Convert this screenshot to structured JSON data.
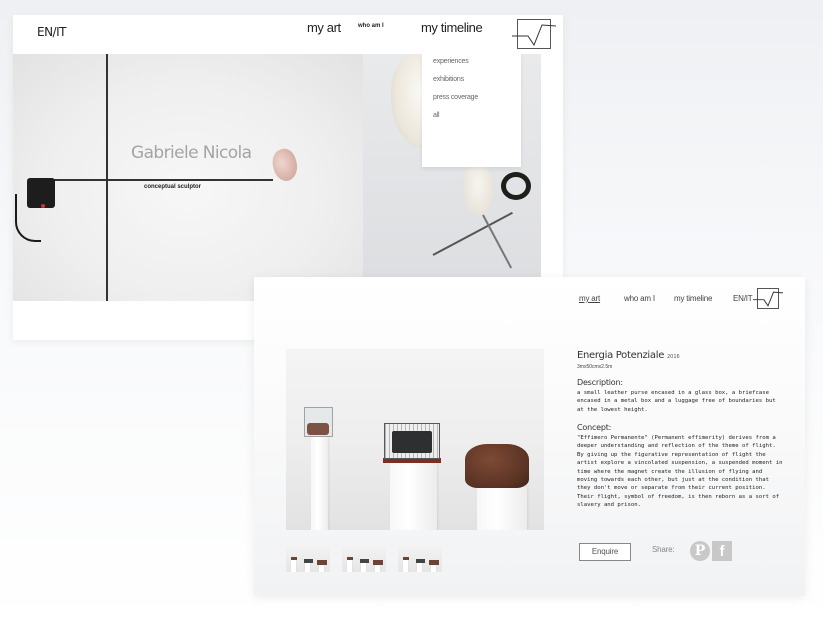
{
  "homepage": {
    "language_switch": "EN/IT",
    "nav": {
      "my_art": "my art",
      "who_am_i": "who am I",
      "my_timeline": "my timeline"
    },
    "hero": {
      "name": "Gabriele Nicola",
      "tagline": "conceptual sculptor"
    },
    "timeline_menu": [
      "experiences",
      "exhibitions",
      "press coverage",
      "all"
    ]
  },
  "detail": {
    "nav": {
      "my_art": "my art",
      "who_am_i": "who am I",
      "my_timeline": "my timeline",
      "language_switch": "EN/IT"
    },
    "artwork": {
      "title": "Energia Potenziale",
      "year": "2016",
      "dimensions": "3mx50cmx2.5m",
      "description_heading": "Description:",
      "description": "a small leather purse encased in a glass box, a briefcase encased in a metal box and a luggage free of boundaries but at the lowest height.",
      "concept_heading": "Concept:",
      "concept": "\"Effimero Permanente\" (Permanent effimerity) derives from a deeper understanding and reflection of the theme of flight. By giving up the figurative representation of flight the artist explore a vincolated suspension, a suspended moment in time where the magnet create the illusion of flying and moving towards each other, but just at the condition that they don't move or separate from their current position. Their flight, symbol of freedom, is then reborn as a sort of slavery and prison."
    },
    "enquire_label": "Enquire",
    "share_label": "Share:",
    "social_icons": [
      "pinterest-icon",
      "facebook-icon"
    ]
  }
}
